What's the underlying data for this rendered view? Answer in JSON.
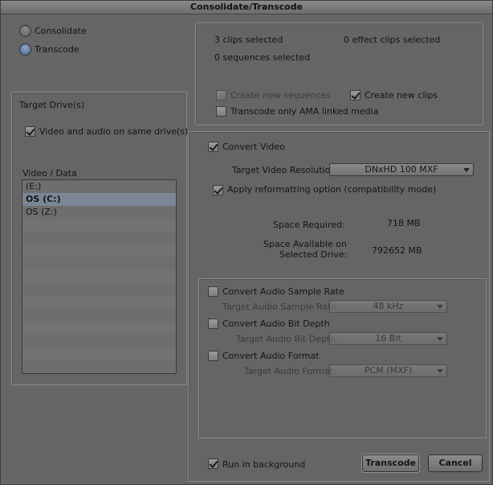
{
  "window": {
    "title": "Consolidate/Transcode"
  },
  "mode": {
    "options": [
      {
        "label": "Consolidate",
        "selected": false
      },
      {
        "label": "Transcode",
        "selected": true
      }
    ]
  },
  "summary": {
    "clips_selected": "3 clips selected",
    "effect_clips_selected": "0 effect clips selected",
    "sequences_selected": "0 sequences selected"
  },
  "options": {
    "create_new_sequences": {
      "label": "Create new sequences",
      "checked": false,
      "enabled": false
    },
    "create_new_clips": {
      "label": "Create new clips",
      "checked": true,
      "enabled": true
    },
    "transcode_only_ama": {
      "label": "Transcode only AMA linked media",
      "checked": false,
      "enabled": true
    }
  },
  "target_drives": {
    "group_label": "Target Drive(s)",
    "same_drive": {
      "label": "Video and audio on same drive(s)",
      "checked": true
    },
    "list_header": "Video / Data",
    "drives": [
      {
        "label": "(E:)",
        "selected": false
      },
      {
        "label": "OS (C:)",
        "selected": true
      },
      {
        "label": "OS (Z:)",
        "selected": false
      }
    ]
  },
  "video": {
    "convert_video": {
      "label": "Convert Video",
      "checked": true
    },
    "resolution_label": "Target Video Resolution:",
    "resolution_value": "DNxHD 100  MXF",
    "reformat": {
      "label": "Apply reformatting option (compatibility mode)",
      "checked": true
    },
    "space_required_label": "Space Required:",
    "space_required_value": "718 MB",
    "space_available_label_1": "Space Available on",
    "space_available_label_2": "Selected Drive:",
    "space_available_value": "792652 MB"
  },
  "audio": {
    "sample_rate": {
      "label": "Convert Audio Sample Rate",
      "checked": false,
      "target_label": "Target Audio Sample Rate:",
      "value": "48 kHz"
    },
    "bit_depth": {
      "label": "Convert Audio Bit Depth",
      "checked": false,
      "target_label": "Target Audio Bit Depth:",
      "value": "16 Bit"
    },
    "format": {
      "label": "Convert Audio Format",
      "checked": false,
      "target_label": "Target Audio Format:",
      "value": "PCM  (MXF)"
    }
  },
  "footer": {
    "run_in_background": {
      "label": "Run in background",
      "checked": true
    },
    "transcode_button": "Transcode",
    "cancel_button": "Cancel"
  },
  "colors": {
    "window_bg": "#666666",
    "selection": "#7b8796",
    "radio_selected": "#4b6a90"
  }
}
